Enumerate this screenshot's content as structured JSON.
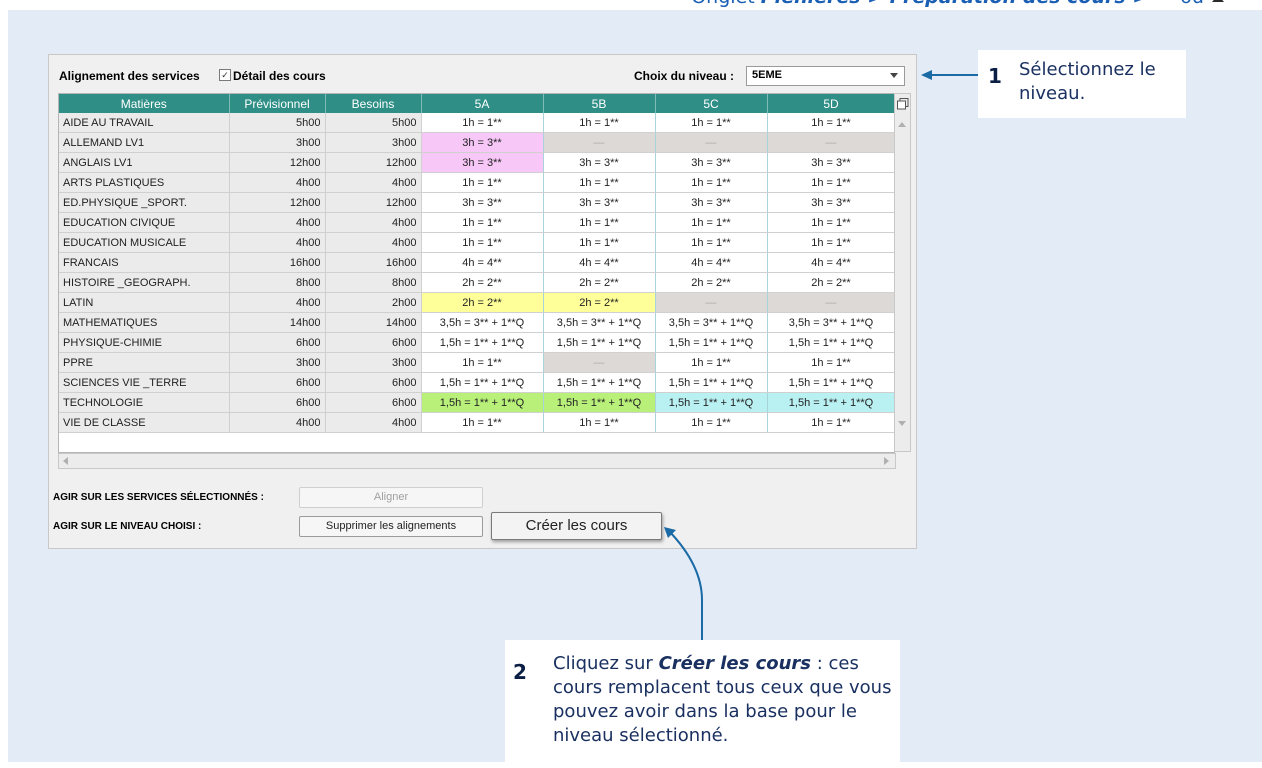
{
  "breadcrumb": {
    "prefix": "Onglet",
    "path": "Plénières > Préparation des cours >",
    "suffix": "ou"
  },
  "toolbar": {
    "title": "Alignement des services",
    "detail_label": "Détail des cours",
    "detail_checked": true,
    "level_label": "Choix du niveau :",
    "level_value": "5EME"
  },
  "table": {
    "headers": [
      "Matières",
      "Prévisionnel",
      "Besoins",
      "5A",
      "5B",
      "5C",
      "5D"
    ],
    "rows": [
      {
        "name": "AIDE AU TRAVAIL",
        "prev": "5h00",
        "bes": "5h00",
        "c": [
          "1h = 1**",
          "1h = 1**",
          "1h = 1**",
          "1h = 1**"
        ],
        "k": [
          "",
          "",
          "",
          ""
        ]
      },
      {
        "name": "ALLEMAND LV1",
        "prev": "3h00",
        "bes": "3h00",
        "c": [
          "3h = 3**",
          "",
          "",
          ""
        ],
        "k": [
          "pink",
          "grey",
          "grey",
          "grey"
        ]
      },
      {
        "name": "ANGLAIS LV1",
        "prev": "12h00",
        "bes": "12h00",
        "c": [
          "3h = 3**",
          "3h = 3**",
          "3h = 3**",
          "3h = 3**"
        ],
        "k": [
          "pink",
          "",
          "",
          ""
        ]
      },
      {
        "name": "ARTS PLASTIQUES",
        "prev": "4h00",
        "bes": "4h00",
        "c": [
          "1h = 1**",
          "1h = 1**",
          "1h = 1**",
          "1h = 1**"
        ],
        "k": [
          "",
          "",
          "",
          ""
        ]
      },
      {
        "name": "ED.PHYSIQUE _SPORT.",
        "prev": "12h00",
        "bes": "12h00",
        "c": [
          "3h = 3**",
          "3h = 3**",
          "3h = 3**",
          "3h = 3**"
        ],
        "k": [
          "",
          "",
          "",
          ""
        ]
      },
      {
        "name": "EDUCATION CIVIQUE",
        "prev": "4h00",
        "bes": "4h00",
        "c": [
          "1h = 1**",
          "1h = 1**",
          "1h = 1**",
          "1h = 1**"
        ],
        "k": [
          "",
          "",
          "",
          ""
        ]
      },
      {
        "name": "EDUCATION MUSICALE",
        "prev": "4h00",
        "bes": "4h00",
        "c": [
          "1h = 1**",
          "1h = 1**",
          "1h = 1**",
          "1h = 1**"
        ],
        "k": [
          "",
          "",
          "",
          ""
        ]
      },
      {
        "name": "FRANCAIS",
        "prev": "16h00",
        "bes": "16h00",
        "c": [
          "4h = 4**",
          "4h = 4**",
          "4h = 4**",
          "4h = 4**"
        ],
        "k": [
          "",
          "",
          "",
          ""
        ]
      },
      {
        "name": "HISTOIRE _GEOGRAPH.",
        "prev": "8h00",
        "bes": "8h00",
        "c": [
          "2h = 2**",
          "2h = 2**",
          "2h = 2**",
          "2h = 2**"
        ],
        "k": [
          "",
          "",
          "",
          ""
        ]
      },
      {
        "name": "LATIN",
        "prev": "4h00",
        "bes": "2h00",
        "c": [
          "2h = 2**",
          "2h = 2**",
          "",
          ""
        ],
        "k": [
          "yellow",
          "yellow",
          "grey",
          "grey"
        ]
      },
      {
        "name": "MATHEMATIQUES",
        "prev": "14h00",
        "bes": "14h00",
        "c": [
          "3,5h = 3** + 1**Q",
          "3,5h = 3** + 1**Q",
          "3,5h = 3** + 1**Q",
          "3,5h = 3** + 1**Q"
        ],
        "k": [
          "",
          "",
          "",
          ""
        ]
      },
      {
        "name": "PHYSIQUE-CHIMIE",
        "prev": "6h00",
        "bes": "6h00",
        "c": [
          "1,5h = 1** + 1**Q",
          "1,5h = 1** + 1**Q",
          "1,5h = 1** + 1**Q",
          "1,5h = 1** + 1**Q"
        ],
        "k": [
          "",
          "",
          "",
          ""
        ]
      },
      {
        "name": "PPRE",
        "prev": "3h00",
        "bes": "3h00",
        "c": [
          "1h = 1**",
          "",
          "1h = 1**",
          "1h = 1**"
        ],
        "k": [
          "",
          "grey",
          "",
          ""
        ]
      },
      {
        "name": "SCIENCES VIE _TERRE",
        "prev": "6h00",
        "bes": "6h00",
        "c": [
          "1,5h = 1** + 1**Q",
          "1,5h = 1** + 1**Q",
          "1,5h = 1** + 1**Q",
          "1,5h = 1** + 1**Q"
        ],
        "k": [
          "",
          "",
          "",
          ""
        ]
      },
      {
        "name": "TECHNOLOGIE",
        "prev": "6h00",
        "bes": "6h00",
        "c": [
          "1,5h = 1** + 1**Q",
          "1,5h = 1** + 1**Q",
          "1,5h = 1** + 1**Q",
          "1,5h = 1** + 1**Q"
        ],
        "k": [
          "green",
          "green",
          "cyan",
          "cyan"
        ]
      },
      {
        "name": "VIE DE CLASSE",
        "prev": "4h00",
        "bes": "4h00",
        "c": [
          "1h = 1**",
          "1h = 1**",
          "1h = 1**",
          "1h = 1**"
        ],
        "k": [
          "",
          "",
          "",
          ""
        ]
      }
    ]
  },
  "actions": {
    "selected_label": "AGIR SUR LES SERVICES SÉLECTIONNÉS :",
    "align_button": "Aligner",
    "level_label": "AGIR SUR LE NIVEAU CHOISI :",
    "remove_button": "Supprimer les alignements",
    "create_button": "Créer les cours"
  },
  "callouts": {
    "step1": {
      "number": "1",
      "text": "Sélectionnez le niveau."
    },
    "step2": {
      "number": "2",
      "bold": "Créer les cours",
      "text_before": "Cliquez sur ",
      "text_after": " : ces cours remplacent tous ceux que vous pouvez avoir dans la base pour le niveau sélectionné."
    }
  },
  "colors": {
    "header_teal": "#2f8f86",
    "callout_arrow": "#1a6aa5",
    "page_bg": "#e3ebf7"
  }
}
